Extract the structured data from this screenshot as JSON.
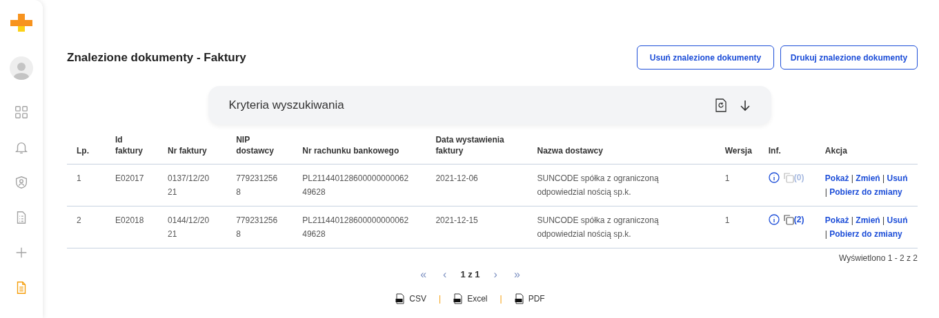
{
  "sidebar": {
    "items": [
      {
        "kind": "grid",
        "selected": false
      },
      {
        "kind": "bell",
        "selected": false
      },
      {
        "kind": "shield",
        "selected": false
      },
      {
        "kind": "checklist",
        "selected": false
      },
      {
        "kind": "plus",
        "selected": false
      },
      {
        "kind": "document",
        "selected": true
      }
    ]
  },
  "page_title": "Znalezione dokumenty - Faktury",
  "buttons": [
    "Usuń znalezione dokumenty",
    "Drukuj znalezione dokumenty"
  ],
  "search_panel": {
    "title": "Kryteria wyszukiwania",
    "expanded": false
  },
  "table": {
    "columns": [
      "Lp.",
      "Id faktury",
      "Nr faktury",
      "NIP dostawcy",
      "Nr rachunku bankowego",
      "Data wystawienia faktury",
      "Nazwa dostawcy",
      "Wersja",
      "Inf.",
      "Akcja"
    ],
    "rows": [
      {
        "cells": [
          "1",
          "E02017",
          "0137/12/20 21",
          "779231256 8",
          "PL211440128600000000062 49628",
          "2021-12-06",
          "SUNCODE spółka z ograniczoną odpowiedzial nością sp.k.",
          "1"
        ],
        "copies": "(0)",
        "copies_disabled": true,
        "actions": [
          "Pokaż",
          "Zmień",
          "Usuń",
          "Pobierz do zmiany"
        ]
      },
      {
        "cells": [
          "2",
          "E02018",
          "0144/12/20 21",
          "779231256 8",
          "PL211440128600000000062 49628",
          "2021-12-15",
          "SUNCODE spółka z ograniczoną odpowiedzial nością sp.k.",
          "1"
        ],
        "copies": "(2)",
        "copies_disabled": false,
        "actions": [
          "Pokaż",
          "Zmień",
          "Usuń",
          "Pobierz do zmiany"
        ]
      }
    ],
    "summary": "Wyświetlono 1 - 2 z 2"
  },
  "pagination": {
    "first": "«",
    "prev": "‹",
    "page": "1 z 1",
    "next": "›",
    "last": "»"
  },
  "exports": [
    "CSV",
    "Excel",
    "PDF"
  ],
  "export_separator": "|",
  "action_separator": "|"
}
